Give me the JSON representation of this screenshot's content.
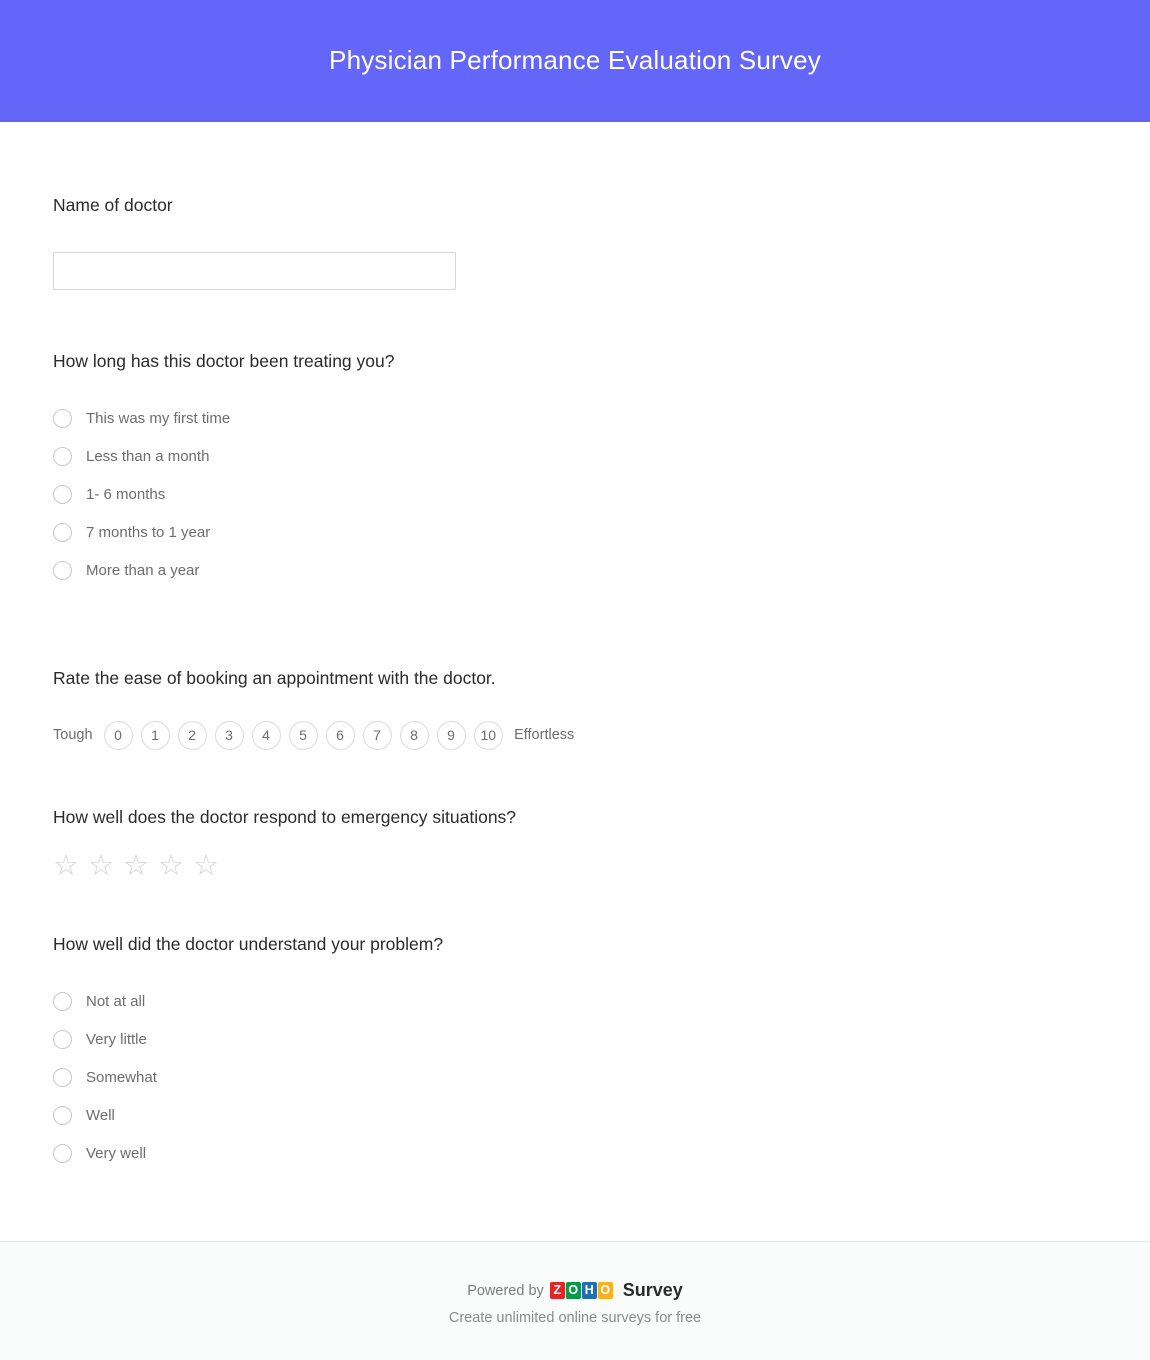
{
  "header": {
    "title": "Physician Performance Evaluation Survey",
    "background_color": "#6366F8",
    "text_color": "#FFFFFF"
  },
  "questions": [
    {
      "id": "name-of-doctor",
      "type": "text",
      "text": "Name of doctor",
      "value": "",
      "placeholder": ""
    },
    {
      "id": "treatment-duration",
      "type": "radio",
      "text": "How long has this doctor been treating you?",
      "options": [
        "This was my first time",
        "Less than a month",
        "1- 6 months",
        "7 months to 1 year",
        "More than a year"
      ],
      "selected": null
    },
    {
      "id": "booking-ease",
      "type": "nps",
      "text": "Rate the ease of booking an appointment with the doctor.",
      "left_label": "Tough",
      "right_label": "Effortless",
      "scale": [
        "0",
        "1",
        "2",
        "3",
        "4",
        "5",
        "6",
        "7",
        "8",
        "9",
        "10"
      ],
      "selected": null
    },
    {
      "id": "emergency-response",
      "type": "star",
      "text": "How well does the doctor respond to emergency situations?",
      "max_stars": 5,
      "rating": 0,
      "star_glyph": "☆",
      "star_color": "#D2D2D2"
    },
    {
      "id": "problem-understanding",
      "type": "radio",
      "text": "How well did the doctor understand your problem?",
      "options": [
        "Not at all",
        "Very little",
        "Somewhat",
        "Well",
        "Very well"
      ],
      "selected": null
    }
  ],
  "footer": {
    "powered_by_label": "Powered by",
    "brand_word": "Survey",
    "tagline": "Create unlimited online surveys for free",
    "logo_tiles": [
      {
        "letter": "Z",
        "color": "#E42527"
      },
      {
        "letter": "O",
        "color": "#089949"
      },
      {
        "letter": "H",
        "color": "#226DB4"
      },
      {
        "letter": "O",
        "color": "#F9B21D"
      }
    ]
  }
}
